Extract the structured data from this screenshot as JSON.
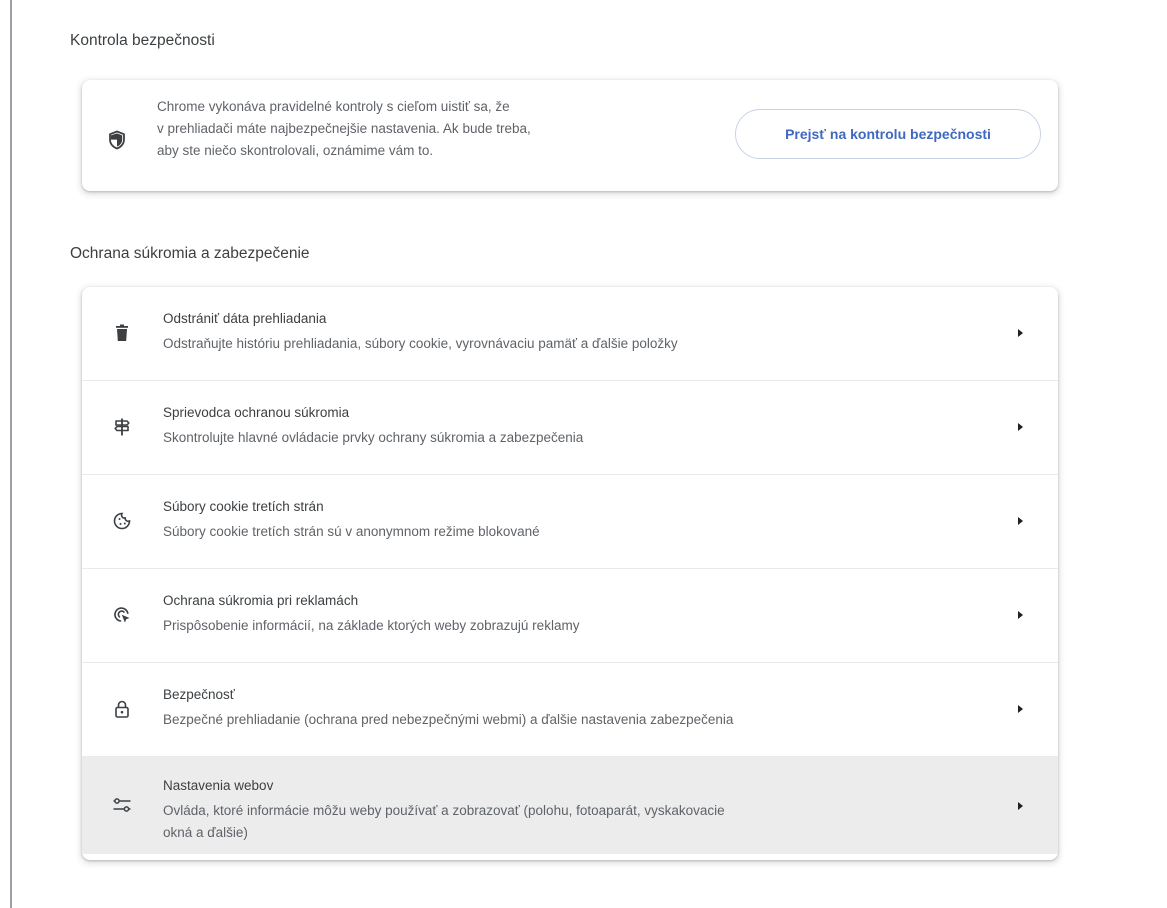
{
  "safety_check": {
    "section_title": "Kontrola bezpečnosti",
    "icon": "shield-icon",
    "description_lines": [
      "Chrome vykonáva pravidelné kontroly s cieľom uistiť sa, že",
      "v prehliadači máte najbezpečnejšie nastavenia. Ak bude treba,",
      "aby ste niečo skontrolovali, oznámime vám to."
    ],
    "button_label": "Prejsť na kontrolu bezpečnosti",
    "accent_color": "#3f68c0"
  },
  "privacy": {
    "section_title": "Ochrana súkromia a zabezpečenie",
    "items": [
      {
        "icon": "trash-icon",
        "title": "Odstrániť dáta prehliadania",
        "subtitle": "Odstraňujte históriu prehliadania, súbory cookie, vyrovnávaciu pamäť a ďalšie položky"
      },
      {
        "icon": "privacy-guide-icon",
        "title": "Sprievodca ochranou súkromia",
        "subtitle": "Skontrolujte hlavné ovládacie prvky ochrany súkromia a zabezpečenia"
      },
      {
        "icon": "cookie-icon",
        "title": "Súbory cookie tretích strán",
        "subtitle": "Súbory cookie tretích strán sú v anonymnom režime blokované"
      },
      {
        "icon": "ad-privacy-icon",
        "title": "Ochrana súkromia pri reklamách",
        "subtitle": "Prispôsobenie informácií, na základe ktorých weby zobrazujú reklamy"
      },
      {
        "icon": "lock-icon",
        "title": "Bezpečnosť",
        "subtitle": "Bezpečné prehliadanie (ochrana pred nebezpečnými webmi) a ďalšie nastavenia zabezpečenia"
      },
      {
        "icon": "site-settings-icon",
        "title": "Nastavenia webov",
        "subtitle_lines": [
          "Ovláda, ktoré informácie môžu weby používať a zobrazovať (polohu, fotoaparát, vyskakovacie",
          "okná a ďalšie)"
        ]
      }
    ]
  }
}
